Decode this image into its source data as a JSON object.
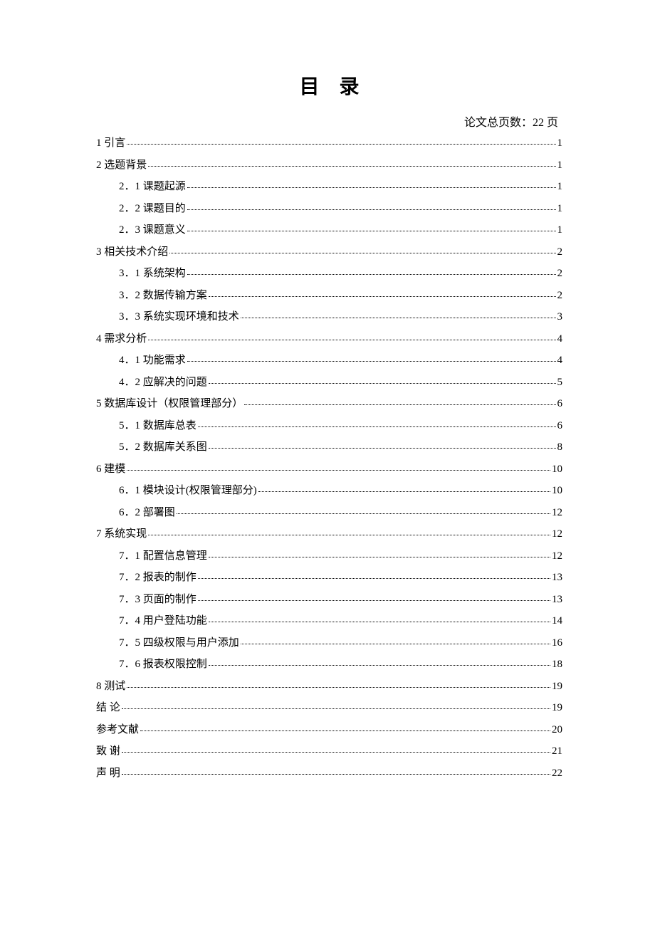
{
  "title": "目录",
  "page_count_text": "论文总页数：22 页",
  "toc": [
    {
      "level": 1,
      "label": "1 引言",
      "page": "1"
    },
    {
      "level": 1,
      "label": "2  选题背景",
      "page": "1"
    },
    {
      "level": 2,
      "label": "2．1 课题起源",
      "page": "1"
    },
    {
      "level": 2,
      "label": "2．2 课题目的",
      "page": "1"
    },
    {
      "level": 2,
      "label": "2．3 课题意义",
      "page": "1"
    },
    {
      "level": 1,
      "label": "3 相关技术介绍",
      "page": "2"
    },
    {
      "level": 2,
      "label": "3．1 系统架构",
      "page": "2"
    },
    {
      "level": 2,
      "label": "3．2 数据传输方案",
      "page": "2"
    },
    {
      "level": 2,
      "label": "3．3 系统实现环境和技术",
      "page": "3"
    },
    {
      "level": 1,
      "label": "4 需求分析",
      "page": "4"
    },
    {
      "level": 2,
      "label": "4．1 功能需求",
      "page": "4"
    },
    {
      "level": 2,
      "label": "4．2 应解决的问题",
      "page": "5"
    },
    {
      "level": 1,
      "label": "5 数据库设计（权限管理部分）",
      "page": "6"
    },
    {
      "level": 2,
      "label": "5．1 数据库总表",
      "page": "6"
    },
    {
      "level": 2,
      "label": "5．2 数据库关系图",
      "page": "8"
    },
    {
      "level": 1,
      "label": "6  建模",
      "page": "10"
    },
    {
      "level": 2,
      "label": "6．1  模块设计(权限管理部分)",
      "page": "10"
    },
    {
      "level": 2,
      "label": "6．2 部署图",
      "page": "12"
    },
    {
      "level": 1,
      "label": "7  系统实现",
      "page": "12"
    },
    {
      "level": 2,
      "label": "7．1 配置信息管理",
      "page": "12"
    },
    {
      "level": 2,
      "label": "7．2 报表的制作",
      "page": "13"
    },
    {
      "level": 2,
      "label": "7．3 页面的制作",
      "page": "13"
    },
    {
      "level": 2,
      "label": "7．4 用户登陆功能",
      "page": "14"
    },
    {
      "level": 2,
      "label": "7．5 四级权限与用户添加",
      "page": "16"
    },
    {
      "level": 2,
      "label": "7．6 报表权限控制",
      "page": "18"
    },
    {
      "level": 1,
      "label": "8  测试",
      "page": "19"
    },
    {
      "level": 1,
      "label": "结    论",
      "page": "19",
      "spaced": false
    },
    {
      "level": 1,
      "label": "参考文献",
      "page": "20"
    },
    {
      "level": 1,
      "label": "致    谢",
      "page": "21",
      "spaced": false
    },
    {
      "level": 1,
      "label": "声    明",
      "page": "22",
      "spaced": false
    }
  ]
}
